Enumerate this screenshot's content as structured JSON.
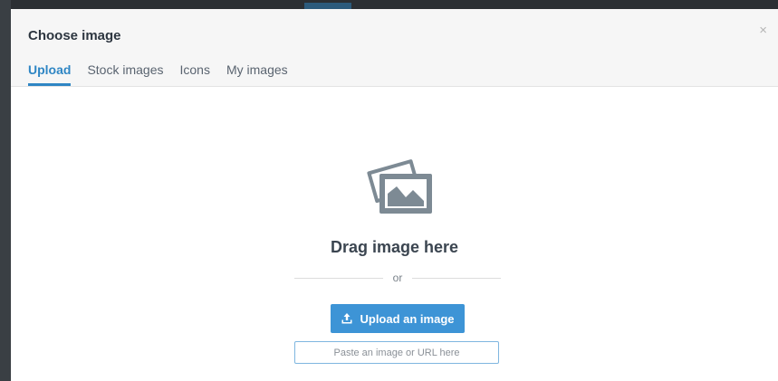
{
  "dialog": {
    "title": "Choose image",
    "close_icon": "close-icon",
    "close_glyph": "×"
  },
  "tabs": [
    {
      "label": "Upload",
      "active": true
    },
    {
      "label": "Stock images",
      "active": false
    },
    {
      "label": "Icons",
      "active": false
    },
    {
      "label": "My images",
      "active": false
    }
  ],
  "upload": {
    "drop_icon": "image-stack-icon",
    "drag_text": "Drag image here",
    "or_text": "or",
    "button_icon": "upload-icon",
    "button_label": "Upload an image",
    "url_placeholder": "Paste an image or URL here",
    "url_value": ""
  },
  "colors": {
    "accent": "#2f86c4",
    "button": "#3d94d6",
    "icon_gray": "#7d8a94",
    "header_bg": "#f6f6f6"
  }
}
